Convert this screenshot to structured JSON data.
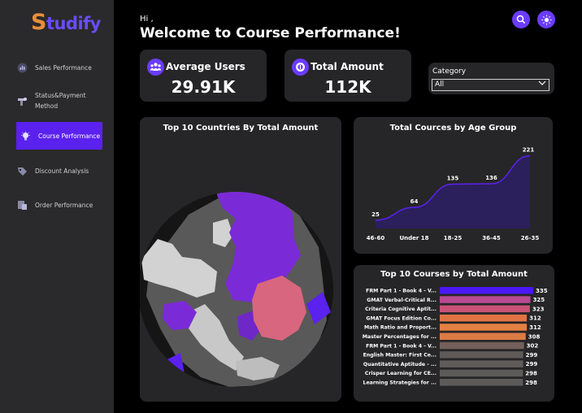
{
  "app": {
    "logo_initial": "S",
    "logo_rest": "tudify"
  },
  "sidebar": {
    "items": [
      {
        "label": "Sales Performance",
        "icon": "chart-icon"
      },
      {
        "label": "Status&Payment Method",
        "icon": "payment-icon"
      },
      {
        "label": "Course Performance",
        "icon": "lightbulb-icon",
        "active": true
      },
      {
        "label": "Discount Analysis",
        "icon": "discount-icon"
      },
      {
        "label": "Order Performance",
        "icon": "order-icon"
      }
    ]
  },
  "header": {
    "greeting": "Hi ,",
    "title": "Welcome to Course Performance!"
  },
  "kpis": {
    "avg_users": {
      "label": "Average Users",
      "value": "29.91K"
    },
    "total_amount": {
      "label": "Total Amount",
      "value": "112K"
    }
  },
  "filter": {
    "label": "Category",
    "value": "All"
  },
  "map": {
    "title": "Top 10 Countries By Total Amount"
  },
  "colors": {
    "accent": "#6a3cff",
    "purple": "#5b21ee",
    "sidebar": "#2a2a2c",
    "card": "#262628"
  },
  "chart_data": [
    {
      "type": "area",
      "title": "Total Cources by Age Group",
      "categories": [
        "46-60",
        "Under 18",
        "18-25",
        "36-45",
        "26-35"
      ],
      "values": [
        25,
        64,
        135,
        136,
        221
      ]
    },
    {
      "type": "bar",
      "title": "Top 10 Courses by Total Amount",
      "categories": [
        "FRM Part 1 - Book 4 - V...",
        "GMAT Verbal-Critical R...",
        "Criteria Cognitive Aptit...",
        "GMAT Focus Edition Co...",
        "Math Ratio and Proport...",
        "Master Percentages for ...",
        "FRM Part 1 - Book 4 - V...",
        "English Master: First Ce...",
        "Quantitative Aptitude - ...",
        "Crisper Learning for CE...",
        "Learning Strategies for ..."
      ],
      "values": [
        335,
        325,
        323,
        312,
        312,
        308,
        302,
        299,
        299,
        298,
        298
      ],
      "bar_colors": [
        "#4b17f5",
        "#b94a93",
        "#c95276",
        "#e07445",
        "#e58042",
        "#dd7b45",
        "#74605a",
        "#5f5a58",
        "#605c5a",
        "#5d5b5a",
        "#5c5b5a"
      ]
    }
  ]
}
